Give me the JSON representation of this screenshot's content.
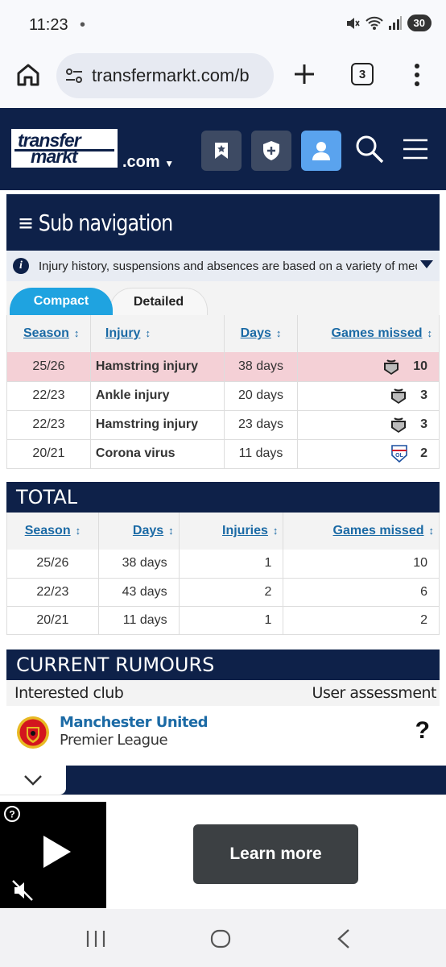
{
  "status_bar": {
    "time": "11:23",
    "dot": "•",
    "battery": "30"
  },
  "browser": {
    "url": "transfermarkt.com/b",
    "tab_count": "3"
  },
  "site": {
    "logo_line1": "transfer",
    "logo_line2": "markt",
    "logo_suffix": ".com"
  },
  "subnav": {
    "title": "≡ Sub navigation"
  },
  "info": {
    "text": "Injury history, suspensions and absences are based on a variety of medi..."
  },
  "tabs": {
    "compact": "Compact",
    "detailed": "Detailed"
  },
  "injury_table": {
    "headers": {
      "season": "Season",
      "injury": "Injury",
      "days": "Days",
      "games_missed": "Games missed"
    },
    "sort_glyph": "↕",
    "rows": [
      {
        "season": "25/26",
        "injury": "Hamstring injury",
        "days": "38 days",
        "club": "newcastle-crest",
        "games": "10"
      },
      {
        "season": "22/23",
        "injury": "Ankle injury",
        "days": "20 days",
        "club": "newcastle-crest",
        "games": "3"
      },
      {
        "season": "22/23",
        "injury": "Hamstring injury",
        "days": "23 days",
        "club": "newcastle-crest",
        "games": "3"
      },
      {
        "season": "20/21",
        "injury": "Corona virus",
        "days": "11 days",
        "club": "lyon-crest",
        "games": "2"
      }
    ]
  },
  "total": {
    "title": "TOTAL",
    "headers": {
      "season": "Season",
      "days": "Days",
      "injuries": "Injuries",
      "games_missed": "Games missed"
    },
    "rows": [
      {
        "season": "25/26",
        "days": "38 days",
        "injuries": "1",
        "games": "10"
      },
      {
        "season": "22/23",
        "days": "43 days",
        "injuries": "2",
        "games": "6"
      },
      {
        "season": "20/21",
        "days": "11 days",
        "injuries": "1",
        "games": "2"
      }
    ]
  },
  "rumours": {
    "title": "CURRENT RUMOURS",
    "col_club": "Interested club",
    "col_assessment": "User assessment",
    "club_name": "Manchester United",
    "league": "Premier League",
    "assessment": "?"
  },
  "ad": {
    "learn_more": "Learn more"
  },
  "colors": {
    "navy": "#0e2149",
    "tab_blue": "#1fa3e0",
    "link": "#1b6aa5",
    "highlight": "#f4d0d6"
  }
}
